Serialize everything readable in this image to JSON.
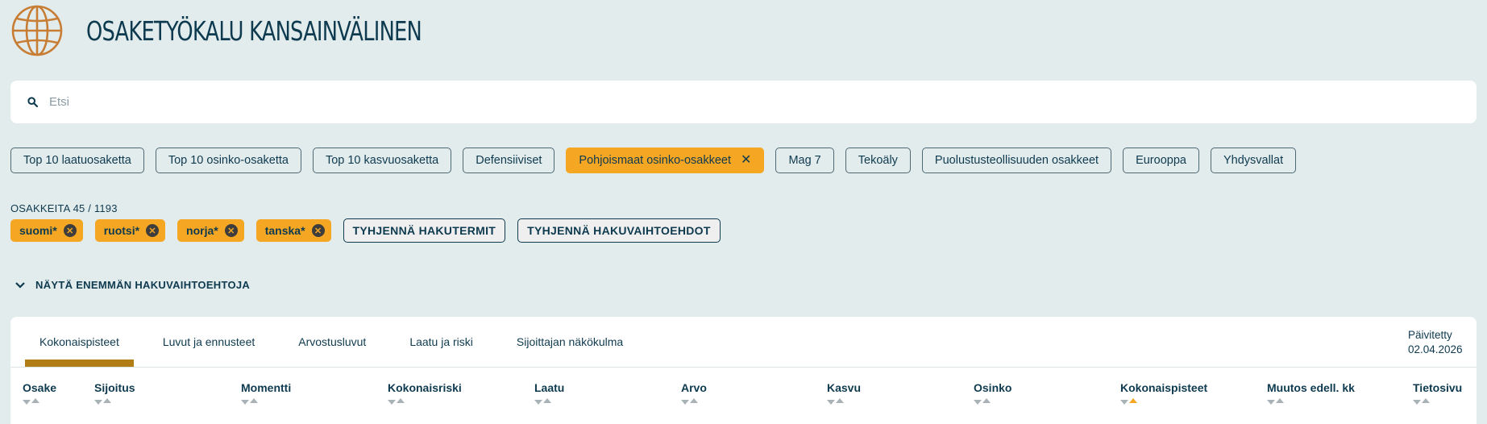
{
  "app": {
    "title": "OSAKETYÖKALU KANSAINVÄLINEN",
    "logo_icon": "globe-icon",
    "logo_color": "#c87d35"
  },
  "search": {
    "placeholder": "Etsi",
    "value": "",
    "icon": "search-icon"
  },
  "quick_filters": [
    {
      "label": "Top 10 laatuosaketta",
      "active": false
    },
    {
      "label": "Top 10 osinko-osaketta",
      "active": false
    },
    {
      "label": "Top 10 kasvuosaketta",
      "active": false
    },
    {
      "label": "Defensiiviset",
      "active": false
    },
    {
      "label": "Pohjoismaat osinko-osakkeet",
      "active": true,
      "close_glyph": "✕"
    },
    {
      "label": "Mag 7",
      "active": false
    },
    {
      "label": "Tekoäly",
      "active": false
    },
    {
      "label": "Puolustusteollisuuden osakkeet",
      "active": false
    },
    {
      "label": "Eurooppa",
      "active": false
    },
    {
      "label": "Yhdysvallat",
      "active": false
    }
  ],
  "results": {
    "count_text": "OSAKKEITA 45 / 1193"
  },
  "active_terms": [
    {
      "label": "suomi*",
      "remove_glyph": "✕"
    },
    {
      "label": "ruotsi*",
      "remove_glyph": "✕"
    },
    {
      "label": "norja*",
      "remove_glyph": "✕"
    },
    {
      "label": "tanska*",
      "remove_glyph": "✕"
    }
  ],
  "actions": {
    "clear_terms": "TYHJENNÄ HAKUTERMIT",
    "clear_options": "TYHJENNÄ HAKUVAIHTOEHDOT"
  },
  "more_options": {
    "label": "NÄYTÄ ENEMMÄN HAKUVAIHTOEHTOJA",
    "icon": "chevron-down-icon"
  },
  "tabs": [
    {
      "label": "Kokonaispisteet",
      "active": true
    },
    {
      "label": "Luvut ja ennusteet",
      "active": false
    },
    {
      "label": "Arvostusluvut",
      "active": false
    },
    {
      "label": "Laatu ja riski",
      "active": false
    },
    {
      "label": "Sijoittajan näkökulma",
      "active": false
    }
  ],
  "updated": {
    "label": "Päivitetty",
    "date": "02.04.2026"
  },
  "columns": [
    {
      "label": "Osake",
      "sorted": "none"
    },
    {
      "label": "Sijoitus",
      "sorted": "none"
    },
    {
      "label": "Momentti",
      "sorted": "none"
    },
    {
      "label": "Kokonaisriski",
      "sorted": "none"
    },
    {
      "label": "Laatu",
      "sorted": "none"
    },
    {
      "label": "Arvo",
      "sorted": "none"
    },
    {
      "label": "Kasvu",
      "sorted": "none"
    },
    {
      "label": "Osinko",
      "sorted": "none"
    },
    {
      "label": "Kokonaispisteet",
      "sorted": "asc"
    },
    {
      "label": "Muutos edell. kk",
      "sorted": "none"
    },
    {
      "label": "Tietosivu",
      "sorted": "none"
    }
  ],
  "colors": {
    "accent": "#f5a623",
    "tab_underline": "#b07d17",
    "text": "#0e3a4f",
    "background": "#e3eced"
  }
}
